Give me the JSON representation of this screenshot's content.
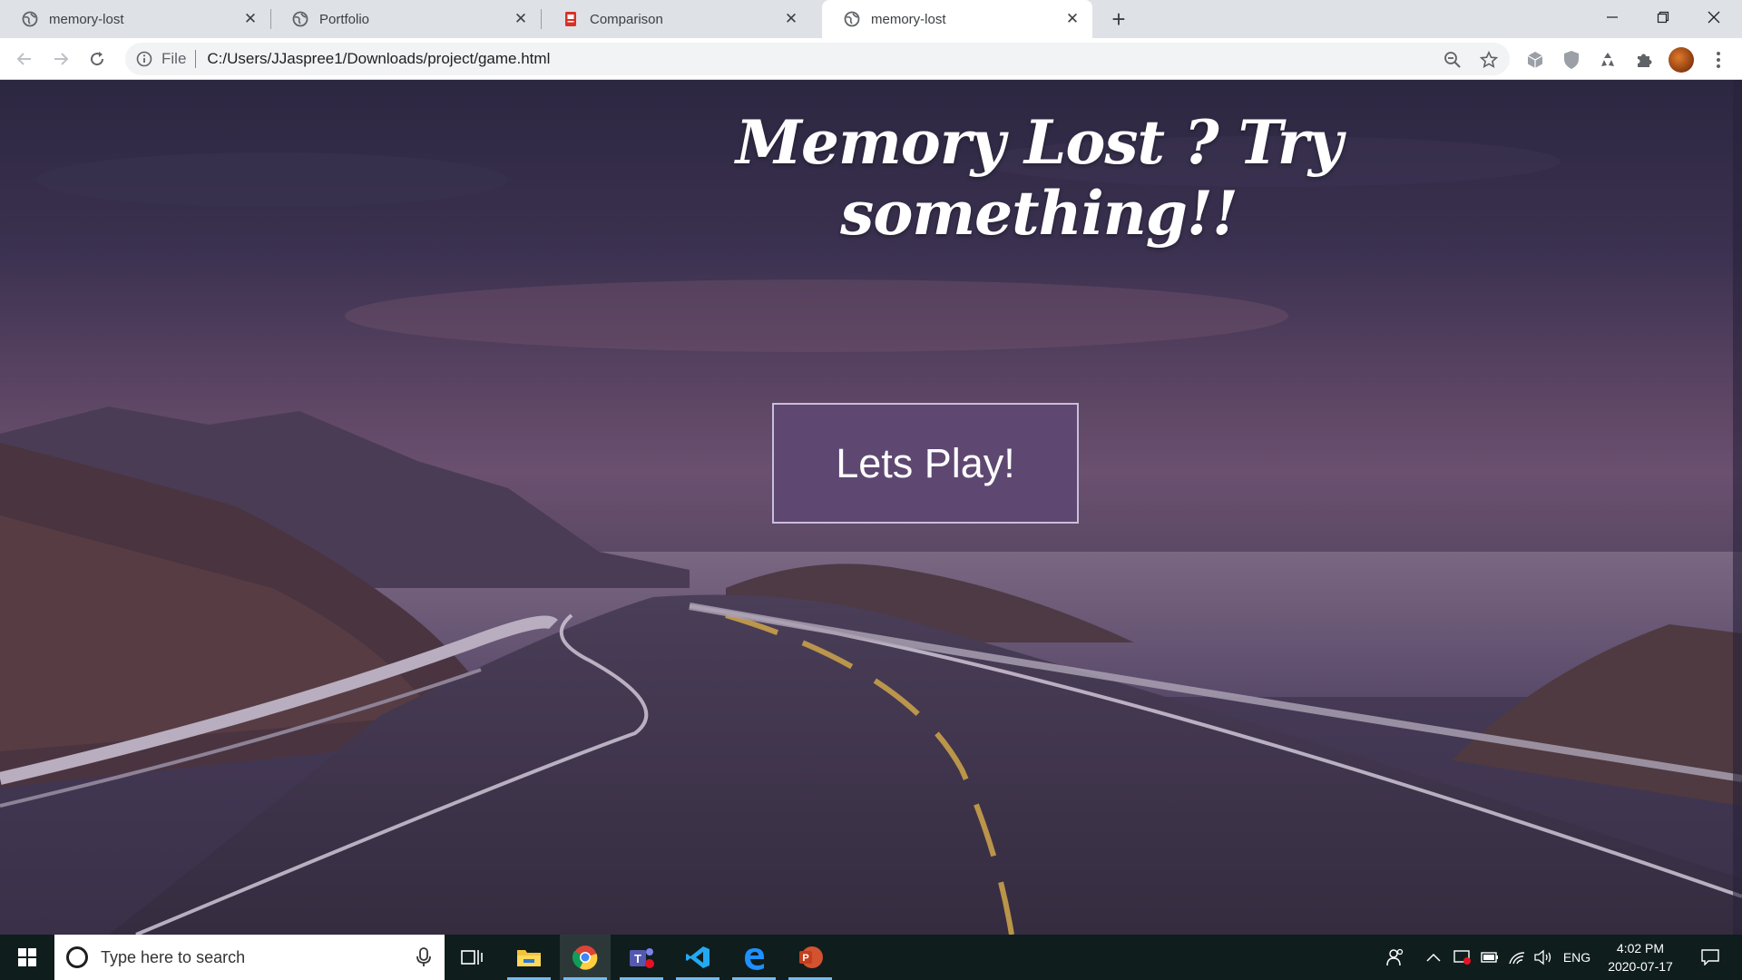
{
  "browser": {
    "tabs": [
      {
        "title": "memory-lost",
        "favicon": "globe-icon",
        "active": false
      },
      {
        "title": "Portfolio",
        "favicon": "globe-icon",
        "active": false
      },
      {
        "title": "Comparison",
        "favicon": "document-icon",
        "active": false
      },
      {
        "title": "memory-lost",
        "favicon": "globe-icon",
        "active": true
      }
    ],
    "address": {
      "scheme_label": "File",
      "url": "C:/Users/JJaspree1/Downloads/project/game.html"
    },
    "accent_avatar": "#b5541c"
  },
  "page": {
    "heading": "Memory Lost ? Try something!!",
    "play_button": "Lets Play!",
    "button_color": "#5e4872"
  },
  "taskbar": {
    "search_placeholder": "Type here to search",
    "apps": [
      "task-view",
      "file-explorer",
      "chrome",
      "teams",
      "vscode",
      "edge",
      "powerpoint"
    ],
    "language": "ENG",
    "time": "4:02 PM",
    "date": "2020-07-17"
  }
}
